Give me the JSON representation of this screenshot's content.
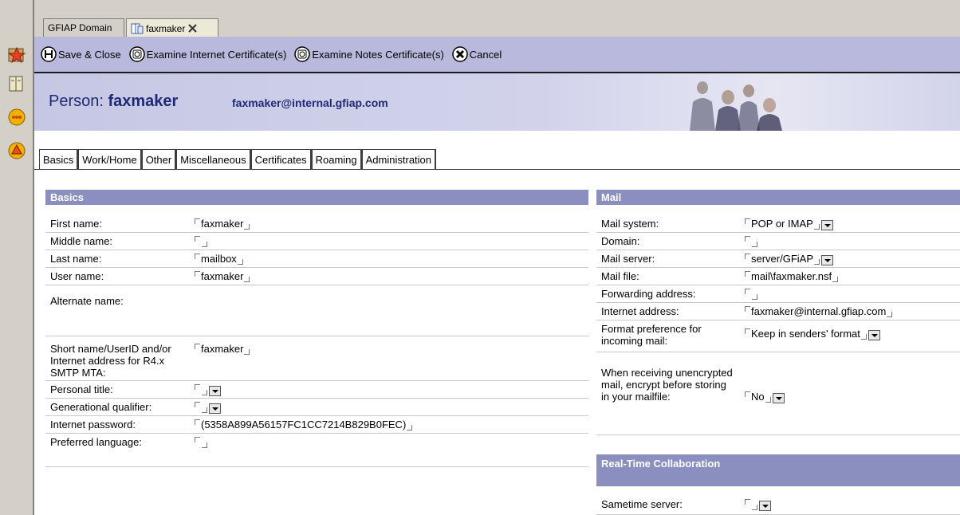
{
  "window_tabs": [
    {
      "label": "GFIAP Domain"
    },
    {
      "label": "faxmaker"
    }
  ],
  "actions": {
    "save_close": "Save & Close",
    "examine_internet": "Examine Internet Certificate(s)",
    "examine_notes": "Examine Notes Certificate(s)",
    "cancel": "Cancel"
  },
  "banner": {
    "prefix": "Person: ",
    "name": "faxmaker",
    "email": "faxmaker@internal.gfiap.com"
  },
  "section_tabs": [
    "Basics",
    "Work/Home",
    "Other",
    "Miscellaneous",
    "Certificates",
    "Roaming",
    "Administration"
  ],
  "basics": {
    "header": "Basics",
    "fields": [
      {
        "label": "First name:",
        "value": "faxmaker"
      },
      {
        "label": "Middle name:",
        "value": ""
      },
      {
        "label": "Last name:",
        "value": "mailbox"
      },
      {
        "label": "User name:",
        "value": "faxmaker"
      },
      {
        "label": "Alternate name:",
        "value": ""
      },
      {
        "label": "Short name/UserID and/or Internet address for R4.x SMTP MTA:",
        "value": "faxmaker"
      },
      {
        "label": "Personal title:",
        "value": ""
      },
      {
        "label": "Generational qualifier:",
        "value": ""
      },
      {
        "label": "Internet password:",
        "value": "(5358A899A56157FC1CC7214B829B0FEC)"
      },
      {
        "label": "Preferred language:",
        "value": ""
      }
    ]
  },
  "mail": {
    "header": "Mail",
    "fields": [
      {
        "label": "Mail system:",
        "value": "POP or IMAP"
      },
      {
        "label": "Domain:",
        "value": ""
      },
      {
        "label": "Mail server:",
        "value": "server/GFiAP"
      },
      {
        "label": "Mail file:",
        "value": "mail\\faxmaker.nsf"
      },
      {
        "label": "Forwarding address:",
        "value": ""
      },
      {
        "label": "Internet address:",
        "value": "faxmaker@internal.gfiap.com"
      },
      {
        "label": "Format preference for incoming mail:",
        "value": "Keep in senders' format"
      },
      {
        "label": "When receiving unencrypted mail, encrypt before storing in your mailfile:",
        "value": "No"
      }
    ]
  },
  "rtc": {
    "header": "Real-Time Collaboration",
    "fields": [
      {
        "label": "Sametime server:",
        "value": ""
      }
    ]
  }
}
